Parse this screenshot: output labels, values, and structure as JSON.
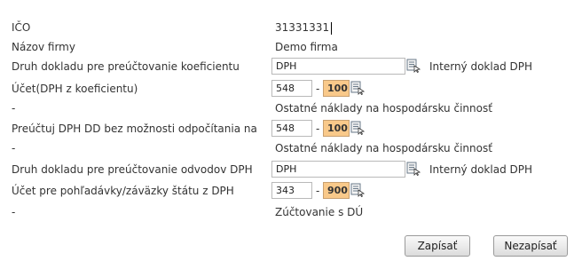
{
  "form": {
    "ico_label": "IČO",
    "ico_value": "31331331",
    "firm_label": "Názov firmy",
    "firm_value": "Demo firma",
    "doc_type_coef_label": "Druh dokladu pre preúčtovanie koeficientu",
    "doc_type_coef_code": "DPH",
    "doc_type_coef_desc": "Interný doklad DPH",
    "account_coef_label": "Účet(DPH z koeficientu)",
    "account_coef_syn": "548",
    "account_coef_sep": "-",
    "account_coef_anal": "100",
    "account_coef_dash": "-",
    "account_coef_desc": "Ostatné náklady na hospodársku činnosť",
    "account_nodeduct_label": "Preúčtuj DPH DD bez možnosti odpočítania na",
    "account_nodeduct_syn": "548",
    "account_nodeduct_sep": "-",
    "account_nodeduct_anal": "100",
    "account_nodeduct_dash": "-",
    "account_nodeduct_desc": "Ostatné náklady na hospodársku činnosť",
    "doc_type_vat_label": "Druh dokladu pre preúčtovanie odvodov DPH",
    "doc_type_vat_code": "DPH",
    "doc_type_vat_desc": "Interný doklad DPH",
    "account_state_label": "Účet pre pohľadávky/záväzky štátu z DPH",
    "account_state_syn": "343",
    "account_state_sep": "-",
    "account_state_anal": "900",
    "account_state_dash": "-",
    "account_state_desc": "Zúčtovanie s DÚ"
  },
  "buttons": {
    "save": "Zapísať",
    "cancel": "Nezapísať"
  },
  "colors": {
    "accent_input": "#f9c98a"
  }
}
